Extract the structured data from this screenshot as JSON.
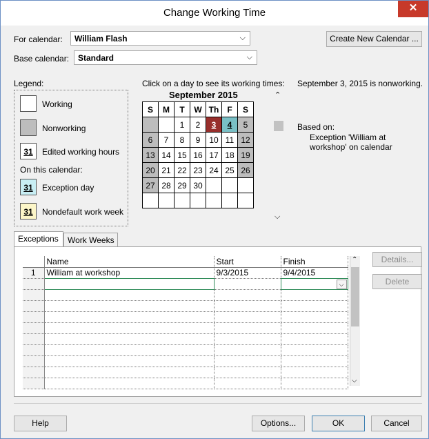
{
  "window": {
    "title": "Change Working Time",
    "close_glyph": "✕"
  },
  "for_calendar": {
    "label": "For calendar:",
    "value": "William Flash"
  },
  "base_calendar": {
    "label": "Base calendar:",
    "value": "Standard"
  },
  "create_new_label": "Create New Calendar ...",
  "legend": {
    "title": "Legend:",
    "working": "Working",
    "nonworking": "Nonworking",
    "edited": "Edited working hours",
    "on_this_calendar": "On this calendar:",
    "exception": "Exception day",
    "nondefault": "Nondefault work week",
    "sample_day": "31"
  },
  "calendar": {
    "instruction": "Click on a day to see its working times:",
    "month": "September 2015",
    "headers": [
      "S",
      "M",
      "T",
      "W",
      "Th",
      "F",
      "S"
    ],
    "weeks": [
      [
        "",
        "",
        "1",
        "2",
        "3",
        "4",
        "5"
      ],
      [
        "6",
        "7",
        "8",
        "9",
        "10",
        "11",
        "12"
      ],
      [
        "13",
        "14",
        "15",
        "16",
        "17",
        "18",
        "19"
      ],
      [
        "20",
        "21",
        "22",
        "23",
        "24",
        "25",
        "26"
      ],
      [
        "27",
        "28",
        "29",
        "30",
        "",
        "",
        ""
      ],
      [
        "",
        "",
        "",
        "",
        "",
        "",
        ""
      ]
    ]
  },
  "info": {
    "status": "September 3, 2015 is nonworking.",
    "based_on_label": "Based on:",
    "based_on_line1": "Exception 'William at",
    "based_on_line2": "workshop' on calendar"
  },
  "tabs": [
    "Exceptions",
    "Work Weeks"
  ],
  "grid": {
    "columns": [
      "",
      "Name",
      "Start",
      "Finish"
    ],
    "rows": [
      {
        "num": "1",
        "name": "William at workshop",
        "start": "9/3/2015",
        "finish": "9/4/2015"
      }
    ]
  },
  "side_buttons": {
    "details": "Details...",
    "delete": "Delete"
  },
  "footer": {
    "help": "Help",
    "options": "Options...",
    "ok": "OK",
    "cancel": "Cancel"
  },
  "colors": {
    "exception_day": "#982f2c",
    "exception_highlight": "#79bfc5",
    "nonworking": "#bdbdbd",
    "close": "#c7392a"
  }
}
